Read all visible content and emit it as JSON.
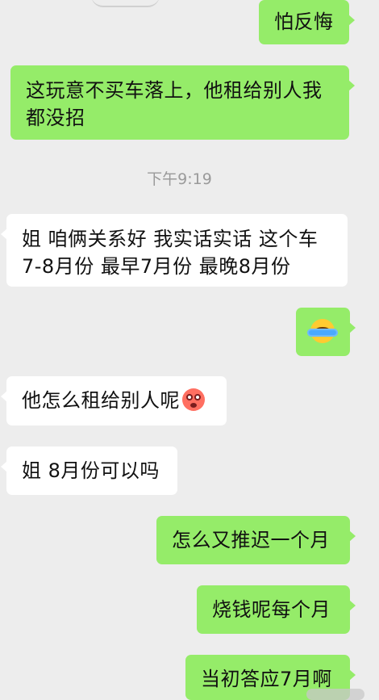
{
  "chat": {
    "messages": [
      {
        "name": "sent-message-1",
        "side": "sent",
        "text": "怕反悔"
      },
      {
        "name": "sent-message-2",
        "side": "sent",
        "lines": [
          "这玩意不买车落上，他租给别人我",
          "都没招"
        ]
      },
      {
        "name": "received-message-1",
        "side": "received",
        "lines": [
          "姐 咱俩关系好 我实话实话 这个车",
          "7-8月份  最早7月份 最晚8月份"
        ]
      },
      {
        "name": "sent-message-3",
        "side": "sent",
        "emoji": "crying-laughing-emoji"
      },
      {
        "name": "received-message-2",
        "side": "received",
        "text": "他怎么租给别人呢",
        "emoji": "flushed-face-emoji"
      },
      {
        "name": "received-message-3",
        "side": "received",
        "text": "姐 8月份可以吗"
      },
      {
        "name": "sent-message-4",
        "side": "sent",
        "text": "怎么又推迟一个月"
      },
      {
        "name": "sent-message-5",
        "side": "sent",
        "text": "烧钱呢每个月"
      },
      {
        "name": "sent-message-6",
        "side": "sent",
        "text": "当初答应7月啊"
      }
    ],
    "timestamp": "下午9:19"
  },
  "colors": {
    "background": "#ededed",
    "sent_bubble": "#95ec69",
    "received_bubble": "#ffffff",
    "timestamp_text": "#9a9a9a"
  }
}
